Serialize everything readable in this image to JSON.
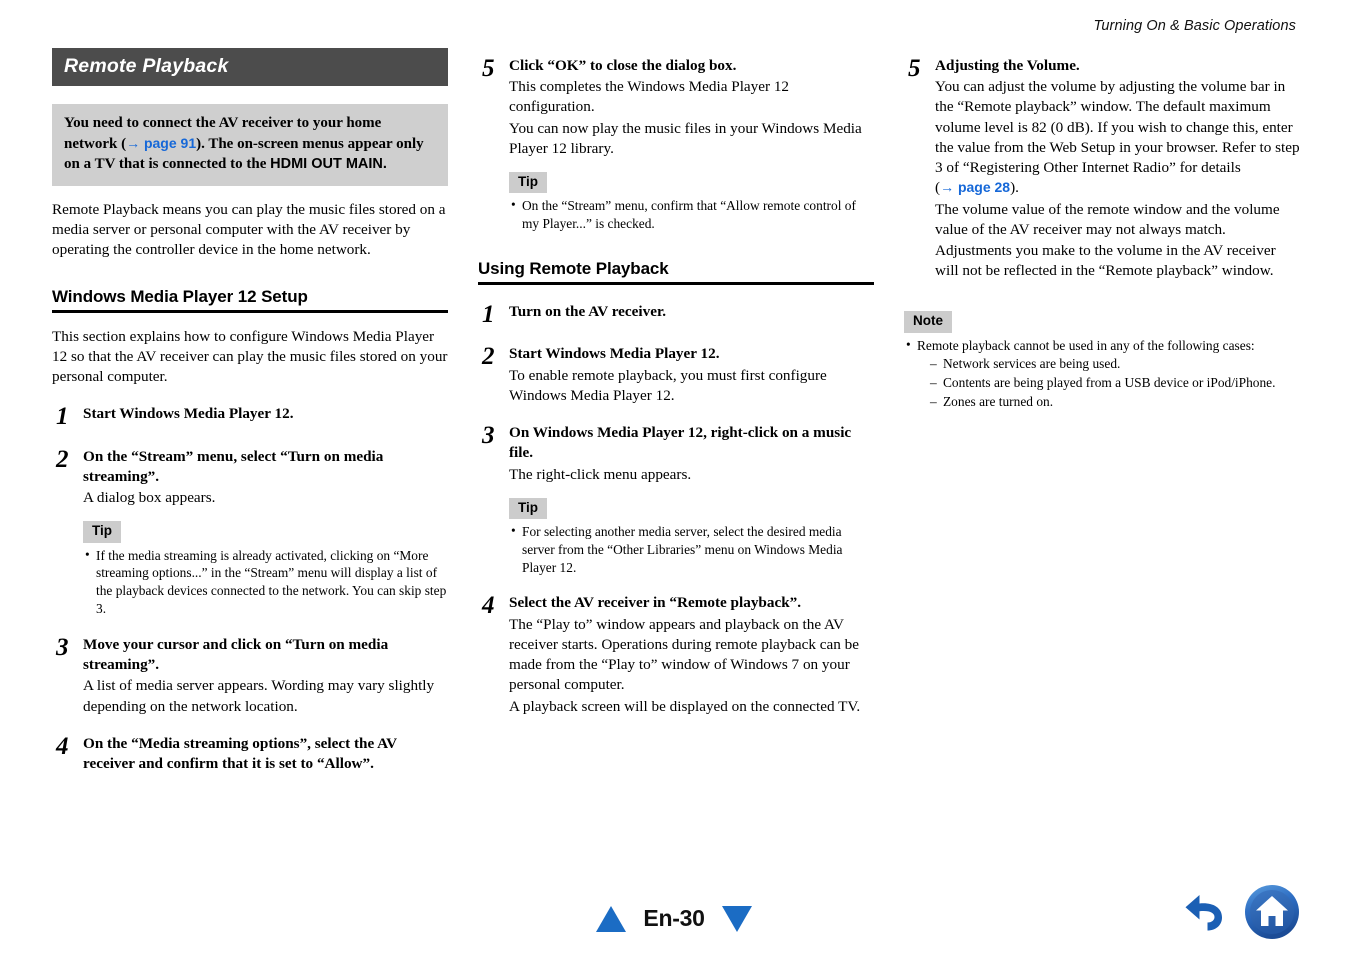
{
  "running_head": "Turning On & Basic Operations",
  "section": {
    "banner_title": "Remote Playback",
    "callout": {
      "part1": "You need to connect the AV receiver to your home network (",
      "link": "→ page 91",
      "part2": "). The on-screen menus appear only on a TV that is connected to the ",
      "emphasis": "HDMI OUT MAIN."
    },
    "intro": "Remote Playback means you can play the music files stored on a media server or personal computer with the AV receiver by operating the controller device in the home network."
  },
  "wmp_setup": {
    "heading": "Windows Media Player 12 Setup",
    "intro": "This section explains how to configure Windows Media Player 12 so that the AV receiver can play the music files stored on your personal computer.",
    "steps": [
      {
        "num": "1",
        "title": "Start Windows Media Player 12.",
        "text": ""
      },
      {
        "num": "2",
        "title": "On the “Stream” menu, select “Turn on media streaming”.",
        "text": "A dialog box appears.",
        "tip_label": "Tip",
        "tips": [
          "If the media streaming is already activated, clicking on “More streaming options...” in the “Stream” menu will display a list of the playback devices connected to the network. You can skip step 3."
        ]
      },
      {
        "num": "3",
        "title": "Move your cursor and click on “Turn on media streaming”.",
        "text": "A list of media server appears. Wording may vary slightly depending on the network location."
      },
      {
        "num": "4",
        "title": "On the “Media streaming options”, select the AV receiver and confirm that it is set to “Allow”.",
        "text": ""
      },
      {
        "num": "5",
        "title": "Click “OK” to close the dialog box.",
        "text": "This completes the Windows Media Player 12 configuration.",
        "text2": "You can now play the music files in your Windows Media Player 12 library.",
        "tip_label": "Tip",
        "tips": [
          "On the “Stream” menu, confirm that “Allow remote control of my Player...” is checked."
        ]
      }
    ]
  },
  "using_remote": {
    "heading": "Using Remote Playback",
    "steps": [
      {
        "num": "1",
        "title": "Turn on the AV receiver.",
        "text": ""
      },
      {
        "num": "2",
        "title": "Start Windows Media Player 12.",
        "text": "To enable remote playback, you must first configure Windows Media Player 12."
      },
      {
        "num": "3",
        "title": "On Windows Media Player 12, right-click on a music file.",
        "text": "The right-click menu appears.",
        "tip_label": "Tip",
        "tips": [
          "For selecting another media server, select the desired media server from the “Other Libraries” menu on Windows Media Player 12."
        ]
      },
      {
        "num": "4",
        "title": "Select the AV receiver in “Remote playback”.",
        "text": "The “Play to” window appears and playback on the AV receiver starts. Operations during remote playback can be made from the “Play to” window of Windows 7 on your personal computer.",
        "text2": "A playback screen will be displayed on the connected TV."
      },
      {
        "num": "5",
        "title": "Adjusting the Volume.",
        "text_a": "You can adjust the volume by adjusting the volume bar in the “Remote playback” window. The default maximum volume level is 82 (0 dB). If you wish to change this, enter the value from the Web Setup in your browser. Refer to step 3 of “Registering Other Internet Radio” for details (",
        "link": "→ page 28",
        "text_a_end": ").",
        "text2": "The volume value of the remote window and the volume value of the AV receiver may not always match.",
        "text3": "Adjustments you make to the volume in the AV receiver will not be reflected in the “Remote playback” window."
      }
    ]
  },
  "note": {
    "label": "Note",
    "lead": "Remote playback cannot be used in any of the following cases:",
    "items": [
      "Network services are being used.",
      "Contents are being played from a USB device or iPod/iPhone.",
      "Zones are turned on."
    ]
  },
  "footer": {
    "page_label": "En-30",
    "prev_icon": "triangle-up-icon",
    "next_icon": "triangle-down-icon",
    "back_icon": "back-arrow-icon",
    "home_icon": "home-icon"
  },
  "colors": {
    "banner_bg": "#4c4c4c",
    "callout_bg": "#cfcfcf",
    "badge_bg": "#cccccc",
    "link_blue": "#1668d8",
    "nav_blue": "#1b6cc4"
  }
}
